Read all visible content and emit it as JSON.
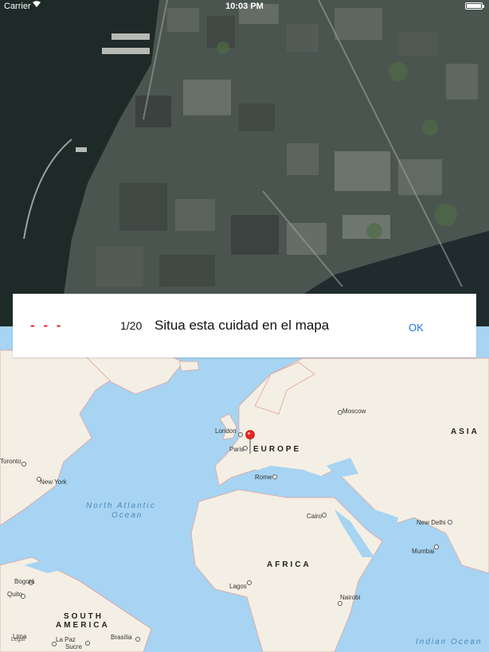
{
  "status_bar": {
    "carrier": "Carrier",
    "time": "10:03 PM"
  },
  "quiz": {
    "progress_marks": "- - -",
    "counter": "1/20",
    "question": "Situa esta cuidad en el mapa",
    "ok_label": "OK"
  },
  "map": {
    "cities": {
      "london": "London",
      "paris": "Paris",
      "moscow": "Moscow",
      "rome": "Rome",
      "cairo": "Cairo",
      "new_delhi": "New Delhi",
      "mumbai": "Mumbai",
      "new_york": "New York",
      "toronto": "Toronto",
      "lagos": "Lagos",
      "nairobi": "Nairobi",
      "bogota": "Bogotá",
      "quito": "Quito",
      "sucre": "Sucre",
      "la_paz": "La Paz",
      "brasilia": "Brasília",
      "lima": "Lima"
    },
    "regions": {
      "europe": "EUROPE",
      "asia": "ASIA",
      "africa": "AFRICA",
      "south_america_1": "SOUTH",
      "south_america_2": "AMERICA"
    },
    "oceans": {
      "north_atlantic_1": "North Atlantic",
      "north_atlantic_2": "Ocean",
      "indian": "Indian Ocean"
    },
    "legal": "Legal"
  },
  "colors": {
    "accent": "#1a73e8",
    "marks": "#e02020",
    "water": "#a6d4f2",
    "land": "#f4efe4",
    "border": "#e4a0a0"
  }
}
